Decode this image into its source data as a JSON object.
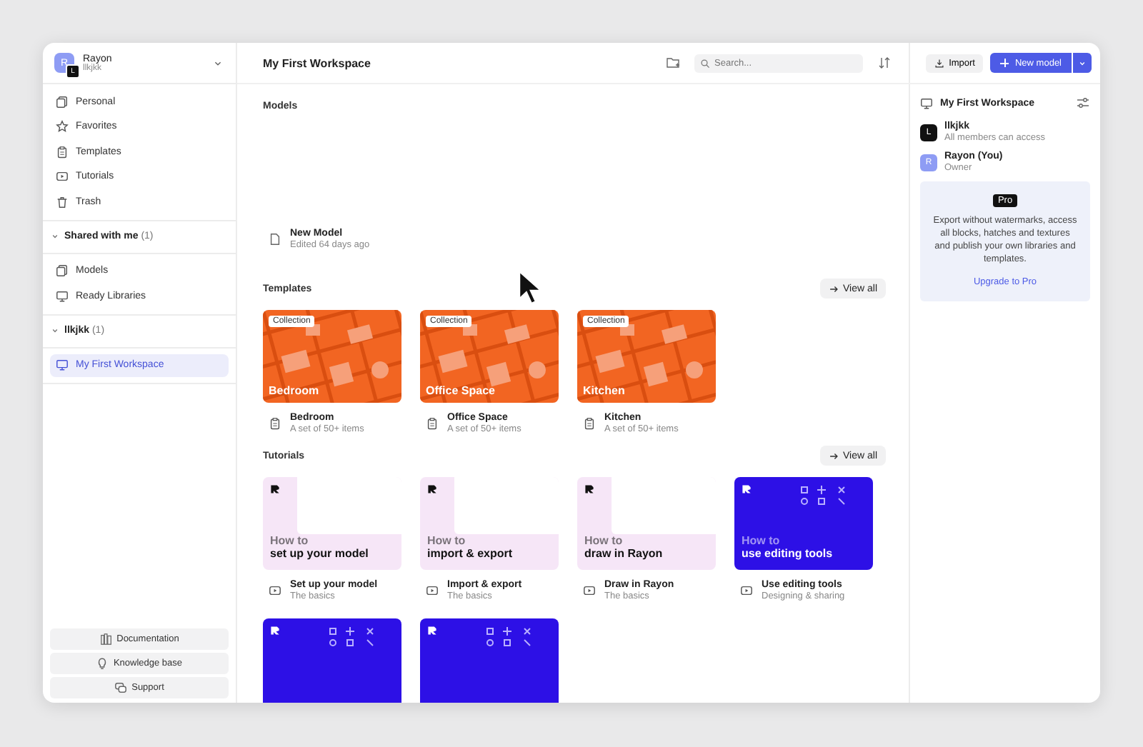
{
  "account": {
    "name": "Rayon",
    "workspace": "llkjkk",
    "avatar_letter": "R",
    "badge_letter": "L"
  },
  "sidebar": {
    "items": [
      {
        "label": "Personal",
        "selected": false
      },
      {
        "label": "Favorites",
        "selected": false
      },
      {
        "label": "Templates",
        "selected": false
      },
      {
        "label": "Tutorials",
        "selected": false
      },
      {
        "label": "Trash",
        "selected": false
      }
    ],
    "sections": [
      {
        "title": "Shared with me",
        "count": "(1)",
        "expanded": true,
        "items": [
          {
            "label": "Models",
            "selected": false
          },
          {
            "label": "Ready Libraries",
            "selected": false
          }
        ]
      },
      {
        "title": "llkjkk",
        "count": "(1)",
        "expanded": true,
        "items": [
          {
            "label": "My First Workspace",
            "selected": true
          }
        ]
      }
    ],
    "footer_buttons": [
      "Documentation",
      "Knowledge base",
      "Support"
    ]
  },
  "topbar": {
    "title": "My First Workspace",
    "search": {
      "placeholder": "Search..."
    },
    "import": "Import",
    "new_model": "New model"
  },
  "models": {
    "title": "Models",
    "items": [
      {
        "name": "New Model",
        "meta": "Edited 64 days ago"
      }
    ]
  },
  "templates": {
    "title": "Templates",
    "view_all": "View all",
    "items": [
      {
        "badge": "Collection",
        "caption": "Bedroom",
        "name": "Bedroom",
        "meta": "A set of 50+ items"
      },
      {
        "badge": "Collection",
        "caption": "Office Space",
        "name": "Office Space",
        "meta": "A set of 50+ items"
      },
      {
        "badge": "Collection",
        "caption": "Kitchen",
        "name": "Kitchen",
        "meta": "A set of 50+ items"
      }
    ]
  },
  "tutorials": {
    "title": "Tutorials",
    "view_all": "View all",
    "items": [
      {
        "kind": "light",
        "caption_top": "How to",
        "caption": "set up your model",
        "name": "Set up your model",
        "meta": "The basics"
      },
      {
        "kind": "light",
        "caption_top": "How to",
        "caption": "import & export",
        "name": "Import & export",
        "meta": "The basics"
      },
      {
        "kind": "light",
        "caption_top": "How to",
        "caption": "draw in Rayon",
        "name": "Draw in Rayon",
        "meta": "The basics"
      },
      {
        "kind": "dark",
        "caption_top": "How to",
        "caption": "use editing tools",
        "name": "Use editing tools",
        "meta": "Designing & sharing"
      },
      {
        "kind": "dark"
      },
      {
        "kind": "dark"
      }
    ]
  },
  "panel": {
    "title": "My First Workspace",
    "members": [
      {
        "letter": "L",
        "name": "llkjkk",
        "role": "All members can access",
        "color": "#111111"
      },
      {
        "letter": "R",
        "name": "Rayon (You)",
        "role": "Owner",
        "color": "#8e9cf4"
      }
    ],
    "pro": {
      "badge": "Pro",
      "text": "Export without watermarks, access all blocks, hatches and textures and publish your own libraries and templates.",
      "link": "Upgrade to Pro"
    }
  }
}
